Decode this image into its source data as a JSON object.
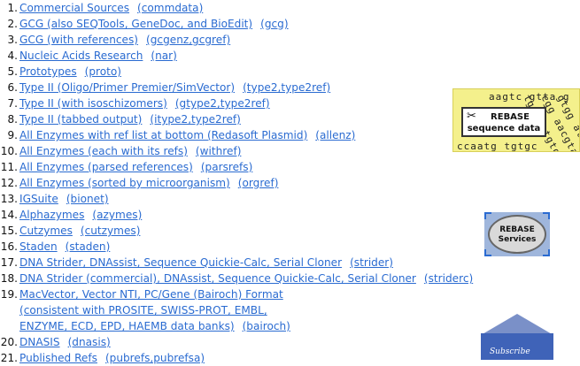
{
  "list": [
    {
      "num": "1.",
      "title": "Commercial Sources",
      "code": "(commdata)"
    },
    {
      "num": "2.",
      "title": "GCG (also SEQTools, GeneDoc, and BioEdit)",
      "code": "(gcg)"
    },
    {
      "num": "3.",
      "title": "GCG (with references)",
      "code": "(gcgenz,gcgref)"
    },
    {
      "num": "4.",
      "title": "Nucleic Acids Research",
      "code": "(nar)"
    },
    {
      "num": "5.",
      "title": "Prototypes",
      "code": "(proto)"
    },
    {
      "num": "6.",
      "title": "Type II (Oligo/Primer Premier/SimVector)",
      "code": "(type2,type2ref)"
    },
    {
      "num": "7.",
      "title": "Type II (with isoschizomers)",
      "code": "(gtype2,type2ref)"
    },
    {
      "num": "8.",
      "title": "Type II (tabbed output)",
      "code": "(itype2,type2ref)"
    },
    {
      "num": "9.",
      "title": "All Enzymes with ref list at bottom (Redasoft Plasmid)",
      "code": "(allenz)"
    },
    {
      "num": "10.",
      "title": "All Enzymes (each with its refs)",
      "code": "(withref)"
    },
    {
      "num": "11.",
      "title": "All Enzymes (parsed references)",
      "code": "(parsrefs)"
    },
    {
      "num": "12.",
      "title": "All Enzymes (sorted by microorganism)",
      "code": "(orgref)"
    },
    {
      "num": "13.",
      "title": "IGSuite",
      "code": "(bionet)"
    },
    {
      "num": "14.",
      "title": "Alphazymes",
      "code": "(azymes)"
    },
    {
      "num": "15.",
      "title": "Cutzymes",
      "code": "(cutzymes)"
    },
    {
      "num": "16.",
      "title": "Staden",
      "code": "(staden)"
    },
    {
      "num": "17.",
      "title": "DNA Strider, DNAssist, Sequence Quickie-Calc, Serial Cloner",
      "code": "(strider)"
    },
    {
      "num": "18.",
      "title": "DNA Strider (commercial), DNAssist, Sequence Quickie-Calc, Serial Cloner",
      "code": "(striderc)"
    },
    {
      "num": "19.",
      "title": "MacVector, Vector NTI, PC/Gene (Bairoch) Format",
      "cont": [
        "(consistent with PROSITE, SWISS-PROT, EMBL,",
        "ENZYME, ECD, EPD, HAEMB data banks)"
      ],
      "code": "(bairoch)"
    },
    {
      "num": "20.",
      "title": "DNASIS",
      "code": "(dnasis)"
    },
    {
      "num": "21.",
      "title": "Published Refs",
      "code": "(pubrefs,pubrefsa)"
    }
  ],
  "seq_banner": {
    "line1": "REBASE",
    "line2": "sequence data",
    "bg_text": [
      "tgtg gtgtg aag",
      "cgg aacgta ctt",
      "gtgg atcc ga",
      "ccaatg tgtgc",
      "aagtc gtta g"
    ]
  },
  "services_banner": {
    "line1": "REBASE",
    "line2": "Services"
  },
  "subscribe_banner": {
    "label": "Subscribe"
  },
  "colors": {
    "link": "#2a6bd1",
    "seq_bg": "#f4f08c",
    "services_bg": "#9fb6dc",
    "subscribe_bg": "#3f63b8"
  }
}
